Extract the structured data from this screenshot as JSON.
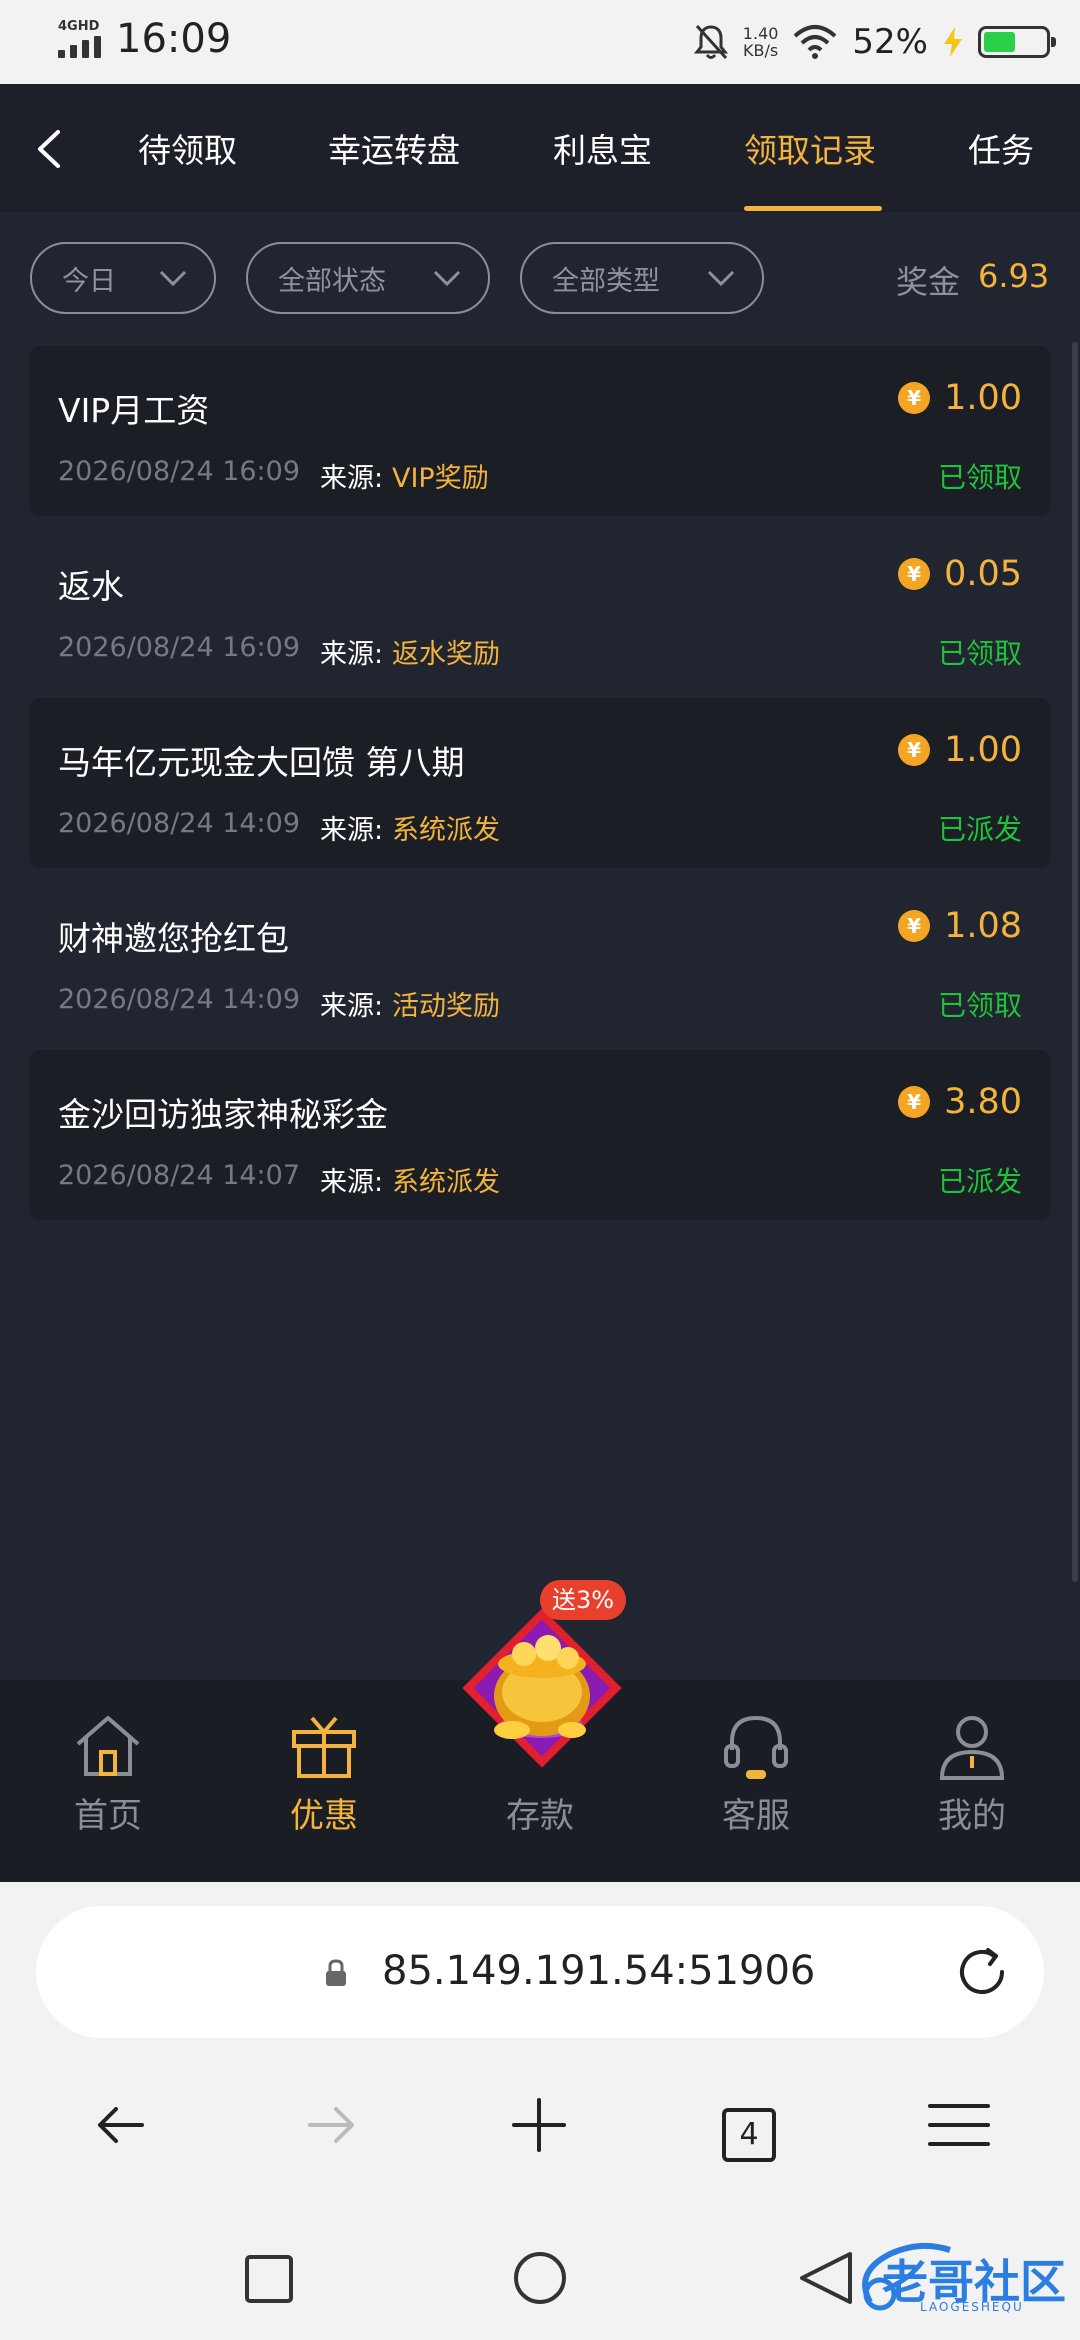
{
  "status_bar": {
    "network": "4GHD",
    "time": "16:09",
    "speed_value": "1.40",
    "speed_unit": "KB/s",
    "battery_pct": "52%",
    "battery_level": 0.52
  },
  "header": {
    "tabs": [
      {
        "label": "待领取"
      },
      {
        "label": "幸运转盘"
      },
      {
        "label": "利息宝"
      },
      {
        "label": "领取记录",
        "active": true
      },
      {
        "label": "任务"
      }
    ]
  },
  "filters": {
    "date": "今日",
    "status": "全部状态",
    "type": "全部类型",
    "bonus_label": "奖金",
    "bonus_value": "6.93"
  },
  "records": [
    {
      "title": "VIP月工资",
      "date": "2026/08/24 16:09",
      "source_label": "来源:",
      "source": "VIP奖励",
      "amount": "1.00",
      "status": "已领取"
    },
    {
      "title": "返水",
      "date": "2026/08/24 16:09",
      "source_label": "来源:",
      "source": "返水奖励",
      "amount": "0.05",
      "status": "已领取"
    },
    {
      "title": "马年亿元现金大回馈 第八期",
      "date": "2026/08/24 14:09",
      "source_label": "来源:",
      "source": "系统派发",
      "amount": "1.00",
      "status": "已派发"
    },
    {
      "title": "财神邀您抢红包",
      "date": "2026/08/24 14:09",
      "source_label": "来源:",
      "source": "活动奖励",
      "amount": "1.08",
      "status": "已领取"
    },
    {
      "title": "金沙回访独家神秘彩金",
      "date": "2026/08/24 14:07",
      "source_label": "来源:",
      "source": "系统派发",
      "amount": "3.80",
      "status": "已派发"
    }
  ],
  "coin_symbol": "¥",
  "tabbar": {
    "items": [
      {
        "label": "首页",
        "icon": "home-icon"
      },
      {
        "label": "优惠",
        "icon": "gift-icon",
        "active": true
      },
      {
        "label": "存款",
        "icon": "gold-pot-icon"
      },
      {
        "label": "客服",
        "icon": "headset-icon"
      },
      {
        "label": "我的",
        "icon": "user-icon"
      }
    ],
    "deposit_badge": "送3%"
  },
  "browser": {
    "url": "85.149.191.54:51906",
    "tab_count": "4"
  },
  "watermark": {
    "text": "老哥社区",
    "sub": "LAOGESHEQU"
  },
  "colors": {
    "accent": "#f4b33d",
    "success": "#1fc23a",
    "background": "#212530"
  }
}
